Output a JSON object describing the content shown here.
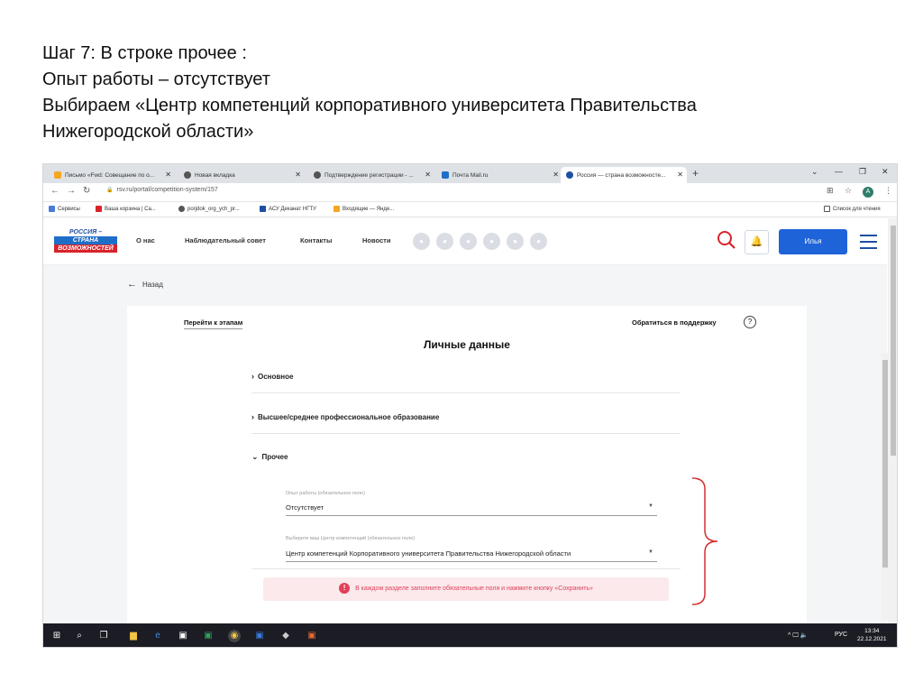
{
  "slide": {
    "line1": "Шаг 7: В строке прочее :",
    "line2": "Опыт работы – отсутствует",
    "line3": "Выбираем «Центр компетенций корпоративного университета Правительства",
    "line4": "Нижегородской области»"
  },
  "browser": {
    "tabs": [
      {
        "label": "Письмо «Fwd: Совещание по о...",
        "icon": "mail-icon"
      },
      {
        "label": "Новая вкладка",
        "icon": "chrome-icon"
      },
      {
        "label": "Подтверждение регистрации - ...",
        "icon": "chrome-icon"
      },
      {
        "label": "Почта Mail.ru",
        "icon": "mail-icon"
      },
      {
        "label": "Россия — страна возможносте...",
        "icon": "site-icon"
      }
    ],
    "new_tab": "+",
    "url": "rsv.ru/portal/competition-system/157",
    "bookmarks": [
      {
        "label": "Сервисы"
      },
      {
        "label": "Ваша корзина | Са..."
      },
      {
        "label": "porjdok_org_ych_pr..."
      },
      {
        "label": "АСУ Деканат НГТУ"
      },
      {
        "label": "Входящие — Янде..."
      }
    ],
    "reading_list": "Список для чтения",
    "profile_initial": "A"
  },
  "site": {
    "logo": {
      "line1": "РОССИЯ –",
      "line2": "СТРАНА",
      "line3": "ВОЗМОЖНОСТЕЙ"
    },
    "nav": [
      "О нас",
      "Наблюдательный совет",
      "Контакты",
      "Новости"
    ],
    "user_button": "Илья",
    "back": "Назад"
  },
  "card": {
    "stages_link": "Перейти к этапам",
    "support": "Обратиться в поддержку",
    "help": "?",
    "title": "Личные данные",
    "sections": {
      "basic": "Основное",
      "education": "Высшее/среднее профессиональное образование",
      "other": "Прочее"
    },
    "experience": {
      "label": "Опыт работы (обязательное поле)",
      "value": "Отсутствует"
    },
    "center": {
      "label": "Выберите ваш Центр компетенций (обязательное поле)",
      "value": "Центр компетенций Корпоративного университета Правительства Нижегородской области"
    },
    "alert": "В каждом разделе заполните обязательные поля и нажмите кнопку «Сохранить»"
  },
  "taskbar": {
    "lang": "РУС",
    "time": "13:34",
    "date": "22.12.2021"
  },
  "colors": {
    "accent": "#1f63d9",
    "alert_text": "#e0405a",
    "alert_bg": "#fbe9ec",
    "bracket": "#d32f2f"
  }
}
